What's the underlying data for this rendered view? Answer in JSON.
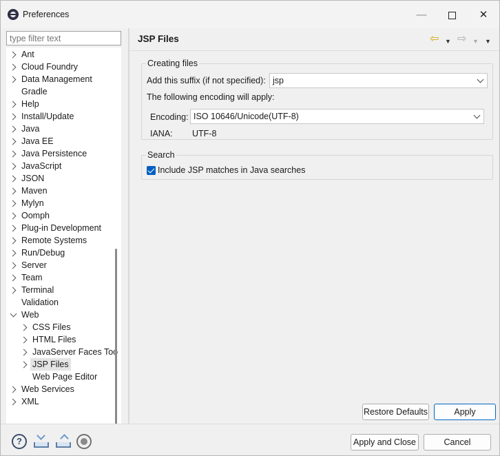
{
  "window": {
    "title": "Preferences",
    "minimize_glyph": "—",
    "close_glyph": "✕"
  },
  "sidebar": {
    "filter_placeholder": "type filter text",
    "items": [
      {
        "label": "Ant",
        "expander": "collapsed"
      },
      {
        "label": "Cloud Foundry",
        "expander": "collapsed"
      },
      {
        "label": "Data Management",
        "expander": "collapsed"
      },
      {
        "label": "Gradle",
        "expander": "none"
      },
      {
        "label": "Help",
        "expander": "collapsed"
      },
      {
        "label": "Install/Update",
        "expander": "collapsed"
      },
      {
        "label": "Java",
        "expander": "collapsed"
      },
      {
        "label": "Java EE",
        "expander": "collapsed"
      },
      {
        "label": "Java Persistence",
        "expander": "collapsed"
      },
      {
        "label": "JavaScript",
        "expander": "collapsed"
      },
      {
        "label": "JSON",
        "expander": "collapsed"
      },
      {
        "label": "Maven",
        "expander": "collapsed"
      },
      {
        "label": "Mylyn",
        "expander": "collapsed"
      },
      {
        "label": "Oomph",
        "expander": "collapsed"
      },
      {
        "label": "Plug-in Development",
        "expander": "collapsed"
      },
      {
        "label": "Remote Systems",
        "expander": "collapsed"
      },
      {
        "label": "Run/Debug",
        "expander": "collapsed"
      },
      {
        "label": "Server",
        "expander": "collapsed"
      },
      {
        "label": "Team",
        "expander": "collapsed"
      },
      {
        "label": "Terminal",
        "expander": "collapsed"
      },
      {
        "label": "Validation",
        "expander": "none"
      },
      {
        "label": "Web",
        "expander": "expanded"
      },
      {
        "label": "CSS Files",
        "expander": "collapsed",
        "child": true
      },
      {
        "label": "HTML Files",
        "expander": "collapsed",
        "child": true
      },
      {
        "label": "JavaServer Faces Too",
        "expander": "collapsed",
        "child": true
      },
      {
        "label": "JSP Files",
        "expander": "collapsed",
        "child": true,
        "selected": true
      },
      {
        "label": "Web Page Editor",
        "expander": "none",
        "child": true
      },
      {
        "label": "Web Services",
        "expander": "collapsed"
      },
      {
        "label": "XML",
        "expander": "collapsed"
      }
    ]
  },
  "page": {
    "title": "JSP Files",
    "creating_files": {
      "legend": "Creating files",
      "suffix_label": "Add this suffix (if not specified):",
      "suffix_value": "jsp",
      "encoding_note": "The following encoding will apply:",
      "encoding_label": "Encoding:",
      "encoding_value": "ISO 10646/Unicode(UTF-8)",
      "iana_label": "IANA:",
      "iana_value": "UTF-8"
    },
    "search": {
      "legend": "Search",
      "checkbox_label": "Include JSP matches in Java searches",
      "checked": true
    },
    "buttons": {
      "restore_defaults": "Restore Defaults",
      "apply": "Apply"
    }
  },
  "footer": {
    "help_glyph": "?",
    "apply_and_close": "Apply and Close",
    "cancel": "Cancel"
  },
  "colors": {
    "accent": "#0067c0",
    "back_arrow": "#d9a400"
  },
  "icons": [
    "help-icon",
    "import-icon",
    "export-icon",
    "record-icon",
    "back-arrow-icon",
    "forward-arrow-icon"
  ]
}
